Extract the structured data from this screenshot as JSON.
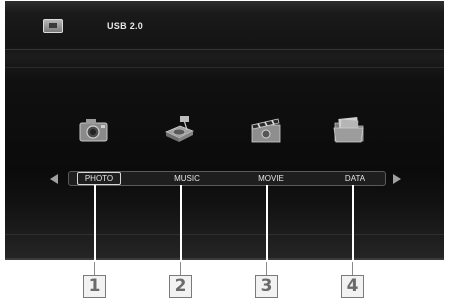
{
  "header": {
    "device_icon": "usb-drive-icon",
    "device_label": "USB 2.0"
  },
  "menu": {
    "items": [
      {
        "label": "PHOTO",
        "icon": "camera-icon",
        "selected": true
      },
      {
        "label": "MUSIC",
        "icon": "music-player-icon",
        "selected": false
      },
      {
        "label": "MOVIE",
        "icon": "clapperboard-icon",
        "selected": false
      },
      {
        "label": "DATA",
        "icon": "folder-icon",
        "selected": false
      }
    ],
    "nav_left_icon": "arrow-left-icon",
    "nav_right_icon": "arrow-right-icon"
  },
  "callouts": [
    "1",
    "2",
    "3",
    "4"
  ]
}
